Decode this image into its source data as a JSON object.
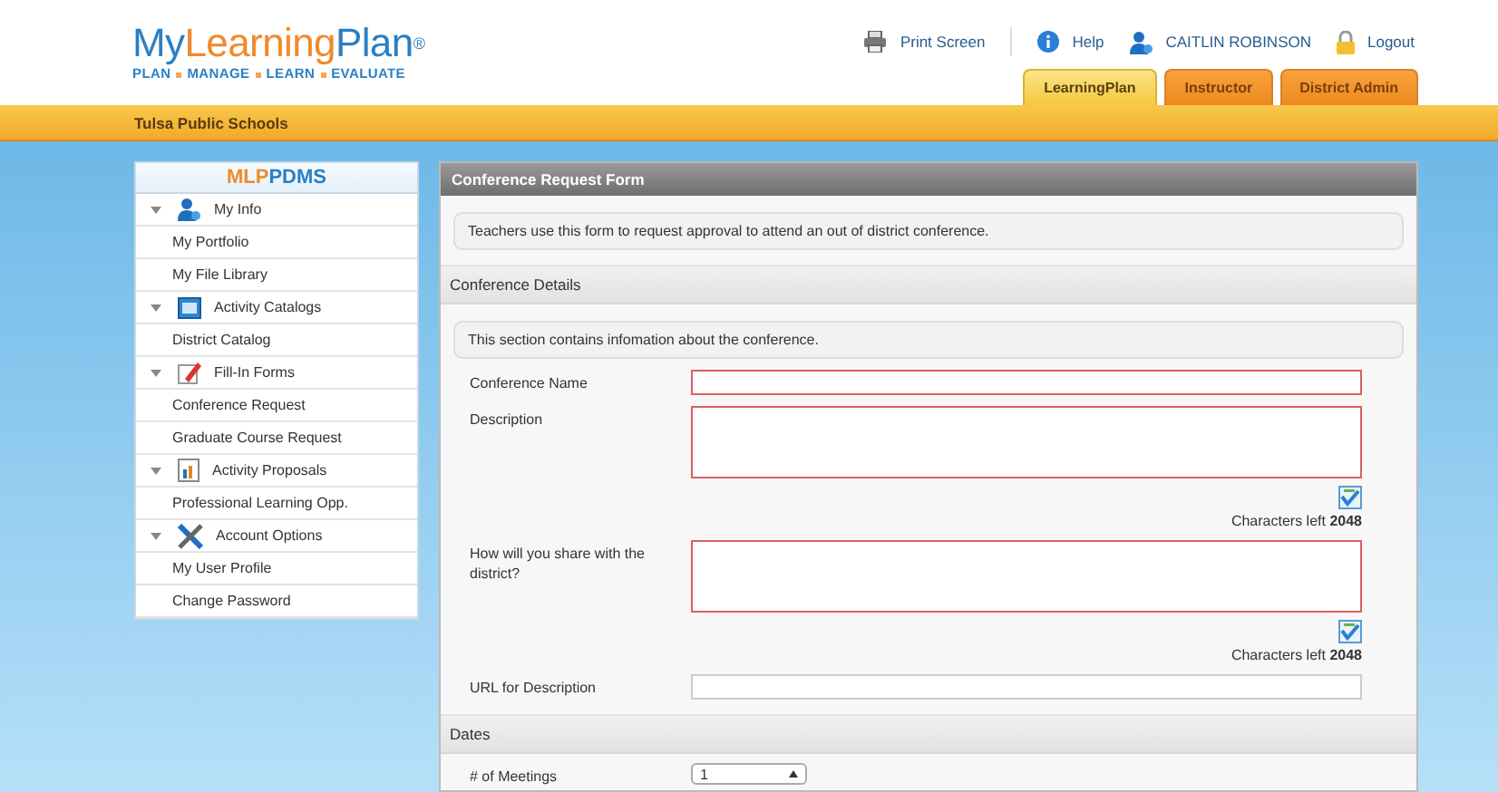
{
  "logo": {
    "name_part1": "My",
    "name_part2": "Learning",
    "name_part3": "Plan",
    "mark": "®",
    "tagline": [
      "PLAN",
      "MANAGE",
      "LEARN",
      "EVALUATE"
    ]
  },
  "top_links": [
    {
      "kind": "print",
      "label": "Print Screen"
    },
    {
      "kind": "help",
      "label": "Help"
    },
    {
      "kind": "user",
      "label": "CAITLIN ROBINSON"
    },
    {
      "kind": "logout",
      "label": "Logout"
    }
  ],
  "tabs": [
    {
      "label": "LearningPlan",
      "selected": true
    },
    {
      "label": "Instructor",
      "selected": false
    },
    {
      "label": "District Admin",
      "selected": false
    }
  ],
  "district": "Tulsa Public Schools",
  "sidebar": {
    "title_part1": "MLP",
    "title_part2": "PDMS",
    "groups": [
      {
        "label": "My Info",
        "expanded": true,
        "children": [
          "My Portfolio",
          "My File Library"
        ]
      },
      {
        "label": "Activity Catalogs",
        "expanded": true,
        "children": [
          "District Catalog"
        ]
      },
      {
        "label": "Fill-In Forms",
        "expanded": true,
        "children": [
          "Conference Request",
          "Graduate Course Request"
        ]
      },
      {
        "label": "Activity Proposals",
        "expanded": true,
        "children": [
          "Professional Learning Opp."
        ]
      },
      {
        "label": "Account Options",
        "expanded": true,
        "children": [
          "My User Profile",
          "Change Password"
        ]
      }
    ]
  },
  "form": {
    "title": "Conference Request Form",
    "intro": "Teachers use this form to request approval to attend an out of district conference.",
    "sections": [
      {
        "title": "Conference Details",
        "info": "This section contains infomation about the conference.",
        "fields": [
          {
            "kind": "input",
            "label": "Conference Name",
            "required": true
          },
          {
            "kind": "textarea",
            "label": "Description",
            "required": true,
            "chars_left": "Characters left **2048**"
          },
          {
            "kind": "textarea",
            "label": "How will you share with the district?",
            "required": true,
            "chars_left": "Characters left **2048**"
          },
          {
            "kind": "input",
            "label": "URL for Description",
            "required": false
          }
        ]
      },
      {
        "title": "Dates",
        "fields": [
          {
            "kind": "spinner",
            "label": "# of Meetings",
            "value": "1"
          }
        ]
      }
    ]
  }
}
